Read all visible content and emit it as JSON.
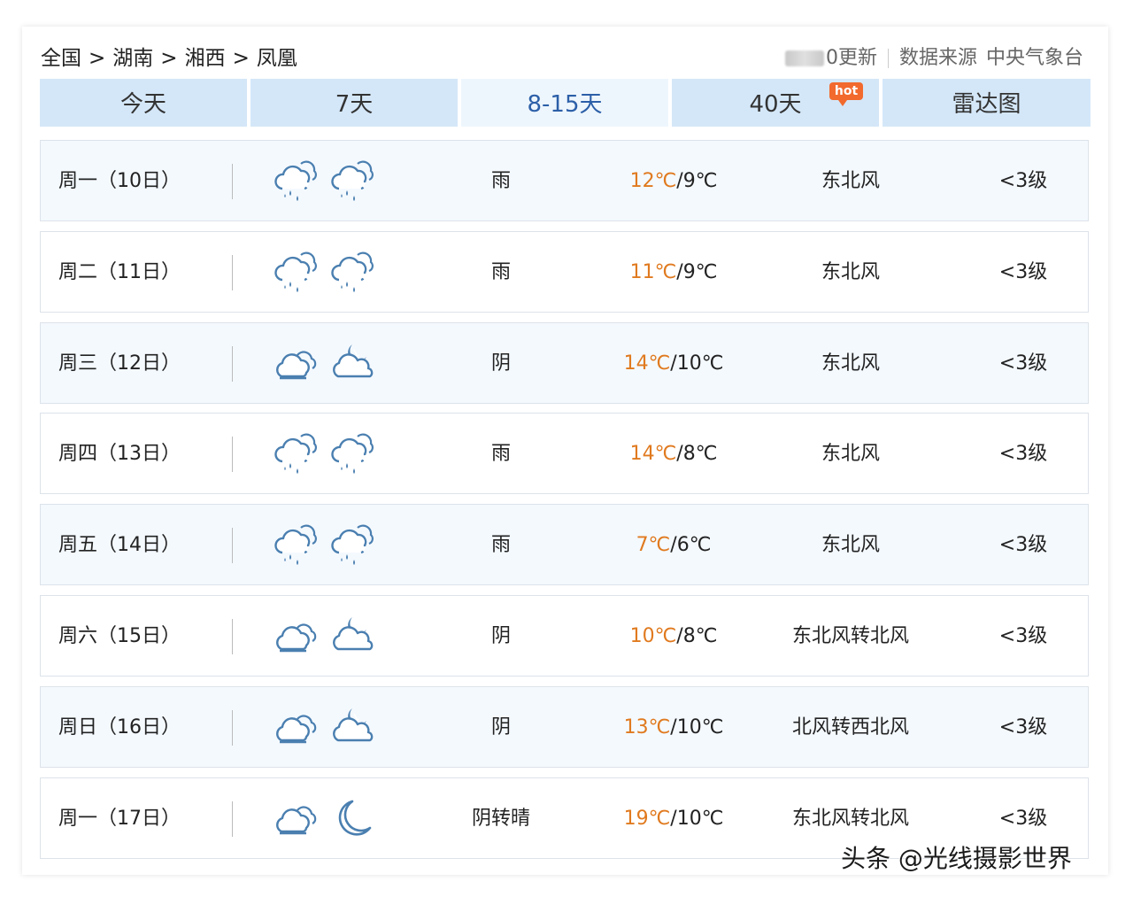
{
  "breadcrumb": {
    "items": [
      "全国",
      "湖南",
      "湘西",
      "凤凰"
    ],
    "separator": ">"
  },
  "update": {
    "suffix": "0更新",
    "source_label": "数据来源",
    "source_name": "中央气象台"
  },
  "tabs": [
    {
      "label": "今天"
    },
    {
      "label": "7天"
    },
    {
      "label": "8-15天"
    },
    {
      "label": "40天"
    },
    {
      "label": "雷达图"
    }
  ],
  "hot_badge": "hot",
  "colors": {
    "tab_bg": "#d4e7f8",
    "tab_active_bg": "#eef6fd",
    "tab_active_text": "#2c5fa8",
    "high_temp": "#e07a1f",
    "icon_blue": "#4a7fb0",
    "row_alt_bg": "#f4f9fe"
  },
  "forecast": [
    {
      "day": "周一（10日）",
      "icon_day": "rain-icon",
      "icon_night": "rain-icon",
      "weather": "雨",
      "high": "12℃",
      "low": "9℃",
      "wind": "东北风",
      "level": "<3级"
    },
    {
      "day": "周二（11日）",
      "icon_day": "rain-icon",
      "icon_night": "rain-icon",
      "weather": "雨",
      "high": "11℃",
      "low": "9℃",
      "wind": "东北风",
      "level": "<3级"
    },
    {
      "day": "周三（12日）",
      "icon_day": "overcast-icon",
      "icon_night": "cloudy-night-icon",
      "weather": "阴",
      "high": "14℃",
      "low": "10℃",
      "wind": "东北风",
      "level": "<3级"
    },
    {
      "day": "周四（13日）",
      "icon_day": "rain-icon",
      "icon_night": "rain-icon",
      "weather": "雨",
      "high": "14℃",
      "low": "8℃",
      "wind": "东北风",
      "level": "<3级"
    },
    {
      "day": "周五（14日）",
      "icon_day": "rain-icon",
      "icon_night": "rain-icon",
      "weather": "雨",
      "high": "7℃",
      "low": "6℃",
      "wind": "东北风",
      "level": "<3级"
    },
    {
      "day": "周六（15日）",
      "icon_day": "overcast-icon",
      "icon_night": "cloudy-night-icon",
      "weather": "阴",
      "high": "10℃",
      "low": "8℃",
      "wind": "东北风转北风",
      "level": "<3级"
    },
    {
      "day": "周日（16日）",
      "icon_day": "overcast-icon",
      "icon_night": "cloudy-night-icon",
      "weather": "阴",
      "high": "13℃",
      "low": "10℃",
      "wind": "北风转西北风",
      "level": "<3级"
    },
    {
      "day": "周一（17日）",
      "icon_day": "overcast-icon",
      "icon_night": "moon-icon",
      "weather": "阴转晴",
      "high": "19℃",
      "low": "10℃",
      "wind": "东北风转北风",
      "level": "<3级"
    }
  ],
  "watermark": "头条 @光线摄影世界"
}
